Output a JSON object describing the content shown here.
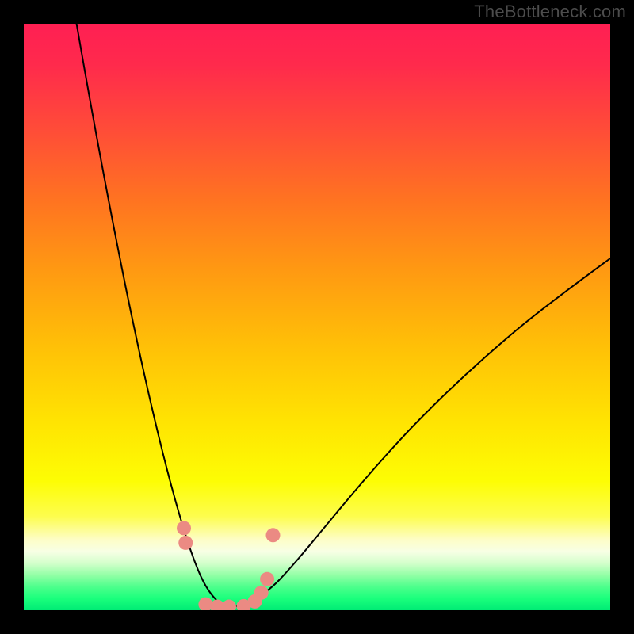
{
  "watermark": "TheBottleneck.com",
  "chart_data": {
    "type": "line",
    "title": "",
    "xlabel": "",
    "ylabel": "",
    "xlim": [
      0,
      100
    ],
    "ylim": [
      0,
      100
    ],
    "background_gradient": {
      "stops": [
        {
          "offset": 0.0,
          "color": "#ff1f53"
        },
        {
          "offset": 0.07,
          "color": "#ff2a4c"
        },
        {
          "offset": 0.18,
          "color": "#ff4c38"
        },
        {
          "offset": 0.3,
          "color": "#ff7321"
        },
        {
          "offset": 0.42,
          "color": "#ff9912"
        },
        {
          "offset": 0.55,
          "color": "#ffc007"
        },
        {
          "offset": 0.68,
          "color": "#ffe402"
        },
        {
          "offset": 0.78,
          "color": "#fdfd04"
        },
        {
          "offset": 0.84,
          "color": "#fdfd4e"
        },
        {
          "offset": 0.88,
          "color": "#fdfdc8"
        },
        {
          "offset": 0.9,
          "color": "#f7ffe5"
        },
        {
          "offset": 0.92,
          "color": "#d3ffcb"
        },
        {
          "offset": 0.94,
          "color": "#93ffa6"
        },
        {
          "offset": 0.96,
          "color": "#4dff8c"
        },
        {
          "offset": 0.98,
          "color": "#1aff7c"
        },
        {
          "offset": 1.0,
          "color": "#00eb75"
        }
      ]
    },
    "series": [
      {
        "name": "left-curve",
        "stroke": "#000000",
        "stroke_width": 2.0,
        "x": [
          9.0,
          10.4,
          11.8,
          13.2,
          14.6,
          16.0,
          17.4,
          18.8,
          20.2,
          21.6,
          23.0,
          24.4,
          25.8,
          27.2,
          28.6,
          30.0,
          31.0,
          32.0,
          33.0,
          34.0,
          35.0
        ],
        "y": [
          100.0,
          92.0,
          84.2,
          76.6,
          69.2,
          62.0,
          55.0,
          48.3,
          41.8,
          35.6,
          29.7,
          24.1,
          18.9,
          14.1,
          9.8,
          6.2,
          4.2,
          2.7,
          1.6,
          0.9,
          0.6
        ]
      },
      {
        "name": "right-curve",
        "stroke": "#000000",
        "stroke_width": 2.0,
        "x": [
          35.0,
          37.0,
          39.0,
          41.0,
          43.5,
          47.0,
          51.0,
          55.5,
          60.5,
          66.0,
          72.0,
          78.5,
          85.5,
          93.0,
          100.0
        ],
        "y": [
          0.6,
          0.8,
          1.5,
          2.9,
          5.1,
          9.0,
          13.8,
          19.2,
          25.0,
          31.0,
          37.0,
          43.0,
          49.0,
          54.8,
          60.0
        ]
      },
      {
        "name": "marker-cluster",
        "type": "scatter",
        "marker_color": "#eb8a83",
        "marker_radius": 9,
        "x": [
          27.3,
          27.6,
          31.0,
          33.0,
          35.0,
          37.5,
          39.4,
          40.5,
          41.5,
          42.5
        ],
        "y": [
          14.0,
          11.5,
          1.0,
          0.6,
          0.6,
          0.7,
          1.5,
          3.0,
          5.3,
          12.8
        ]
      }
    ]
  }
}
